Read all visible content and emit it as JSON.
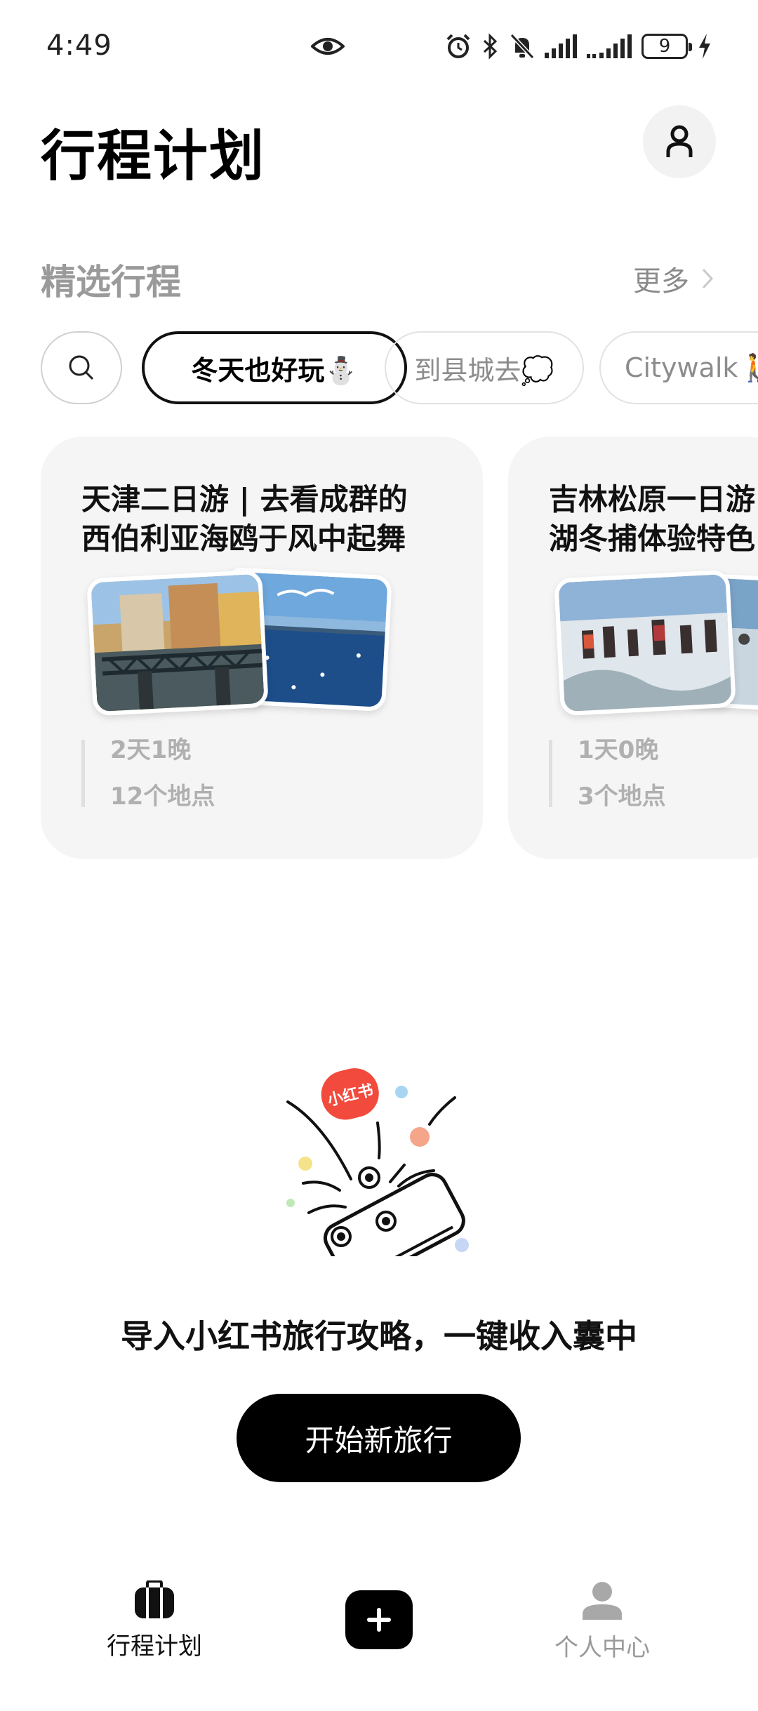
{
  "status_bar": {
    "time": "4:49",
    "battery_level": "9"
  },
  "header": {
    "title": "行程计划"
  },
  "section": {
    "title": "精选行程",
    "more_label": "更多"
  },
  "chips": [
    {
      "label": ""
    },
    {
      "label": "冬天也好玩⛄"
    },
    {
      "label": "到县城去💭"
    },
    {
      "label": "Citywalk🚶"
    }
  ],
  "cards": [
    {
      "title_line1": "天津二日游 | 去看成群的",
      "title_line2": "西伯利亚海鸥于风中起舞",
      "duration": "2天1晚",
      "places": "12个地点"
    },
    {
      "title_line1": "吉林松原一日游",
      "title_line2": "湖冬捕体验特色",
      "duration": "1天0晚",
      "places": "3个地点"
    }
  ],
  "empty_state": {
    "badge_text": "小红书",
    "message": "导入小红书旅行攻略，一键收入囊中",
    "button_label": "开始新旅行"
  },
  "bottom_nav": {
    "trips_label": "行程计划",
    "profile_label": "个人中心"
  }
}
